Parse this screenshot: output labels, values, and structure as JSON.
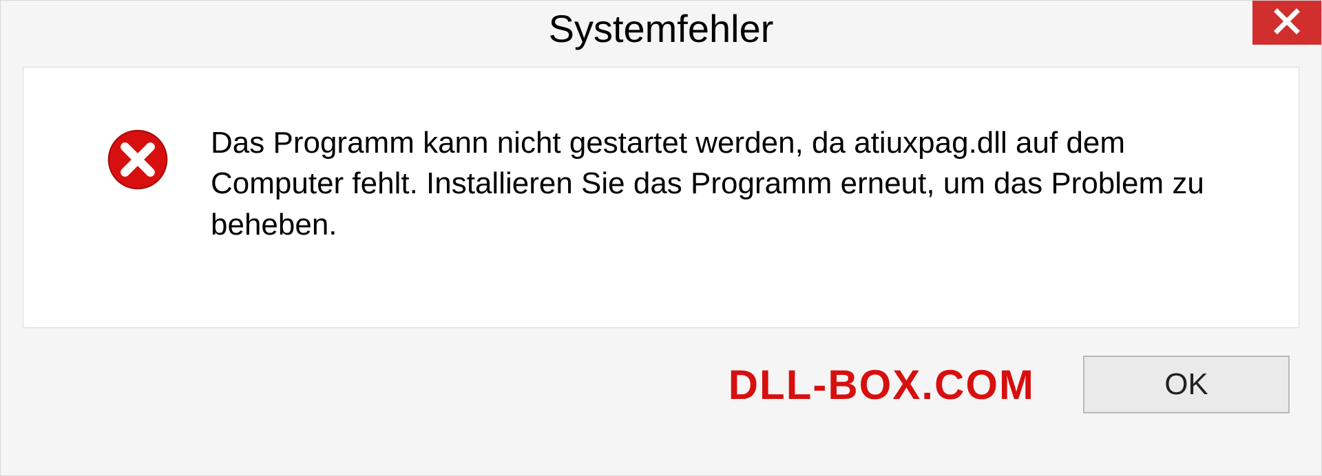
{
  "dialog": {
    "title": "Systemfehler",
    "message": "Das Programm kann nicht gestartet werden, da atiuxpag.dll auf dem Computer fehlt. Installieren Sie das Programm erneut, um das Problem zu beheben.",
    "ok_label": "OK"
  },
  "watermark": "DLL-BOX.COM",
  "colors": {
    "close_bg": "#d12e2e",
    "error_red": "#d80f0f"
  }
}
